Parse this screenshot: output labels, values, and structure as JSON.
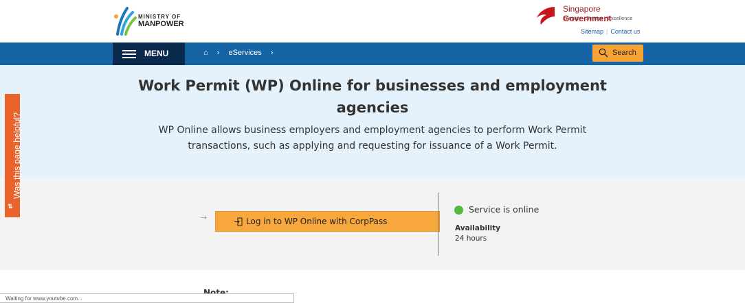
{
  "header": {
    "logo_line1": "MINISTRY OF",
    "logo_line2": "MANPOWER",
    "gov_title_a": "Singapore",
    "gov_title_b": "Government",
    "gov_tagline": "Integrity · Service · Excellence",
    "sitemap": "Sitemap",
    "contact": "Contact us"
  },
  "nav": {
    "menu_label": "MENU",
    "breadcrumb": [
      "eServices"
    ],
    "search_label": "Search"
  },
  "hero": {
    "title": "Work Permit (WP) Online for businesses and employment agencies",
    "description": "WP Online allows business employers and employment agencies to perform Work Permit transactions, such as applying and requesting for issuance of a Work Permit."
  },
  "service": {
    "login_label": "Log in to WP Online with CorpPass",
    "status": "Service is online",
    "status_color": "#55b83f",
    "availability_label": "Availability",
    "availability_value": "24 hours"
  },
  "feedback": {
    "label": "Was this page helpful?"
  },
  "note_label": "Note:",
  "browser_status": "Waiting for www.youtube.com...",
  "colors": {
    "nav_blue": "#1565a6",
    "menu_navy": "#0a2a4d",
    "accent_orange": "#f7a335"
  }
}
